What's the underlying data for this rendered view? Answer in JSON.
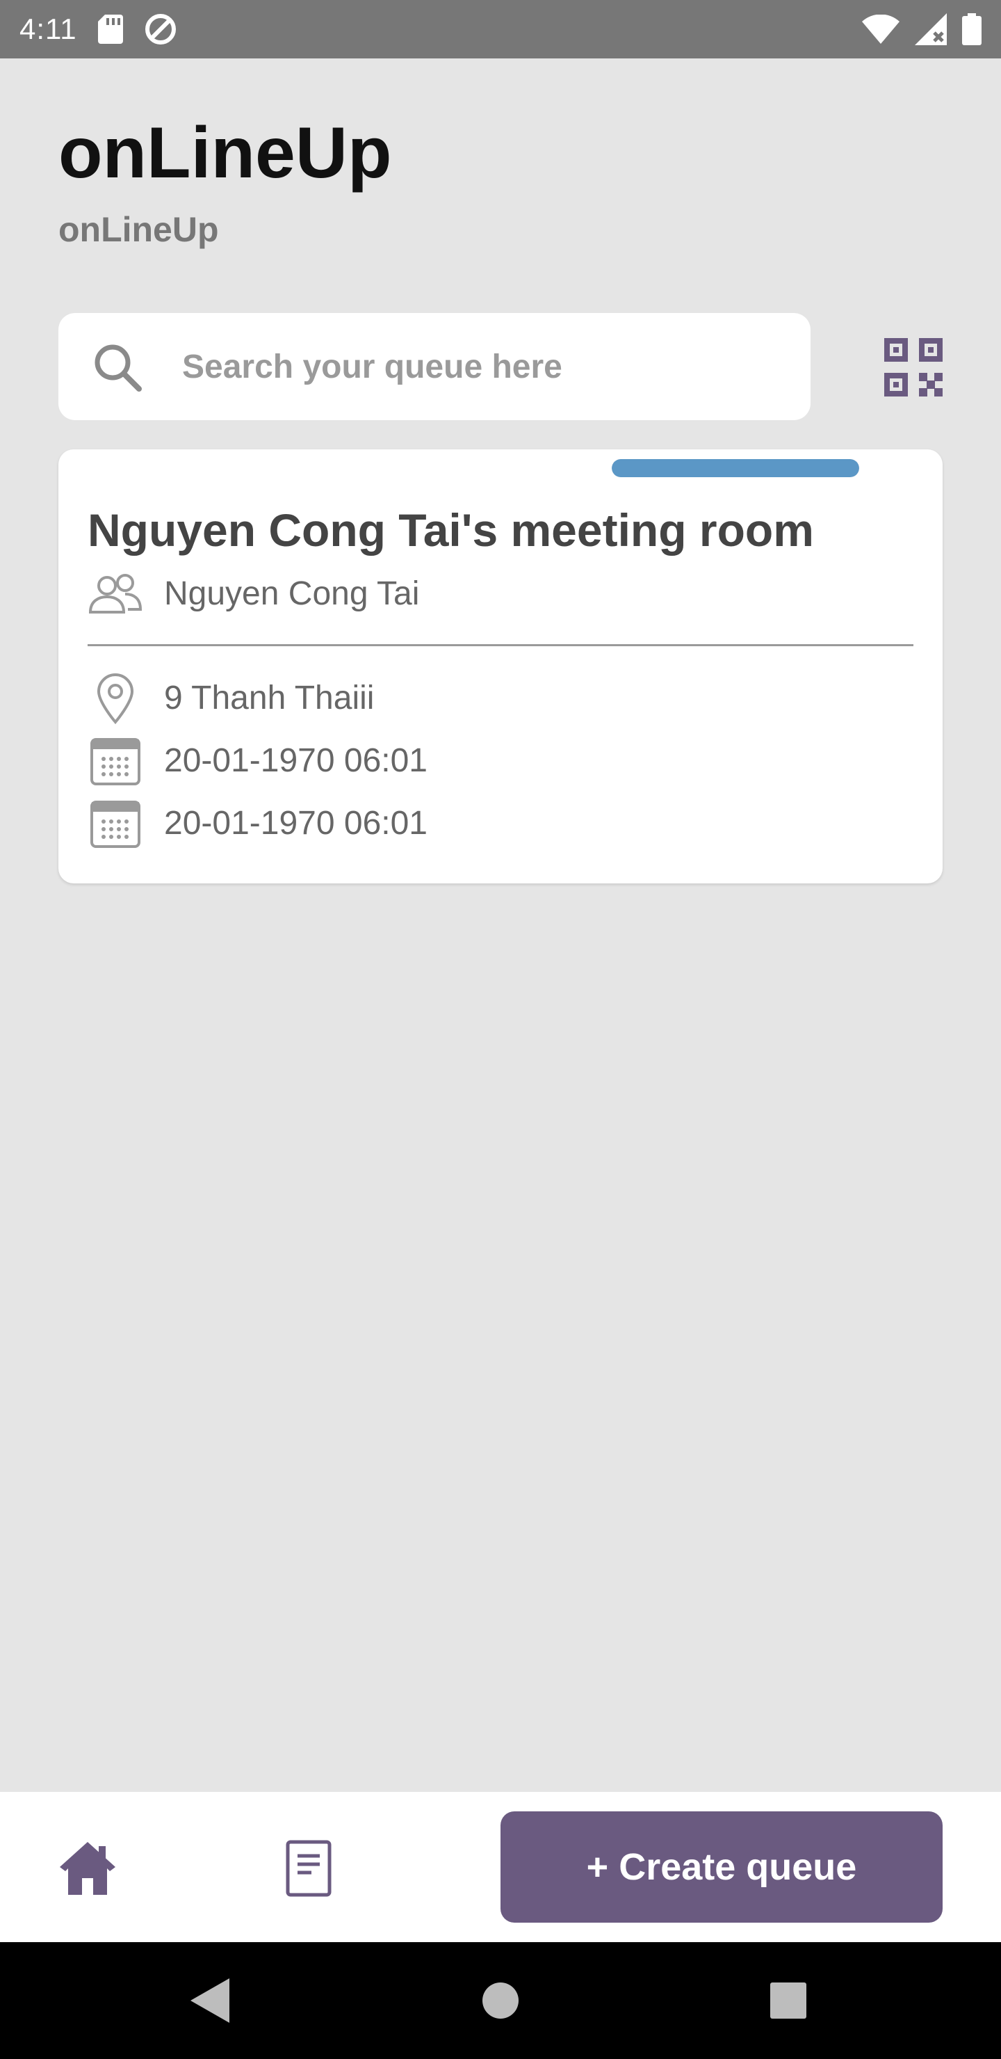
{
  "status_bar": {
    "time": "4:11",
    "icons": [
      "sd-card-icon",
      "data-saver-icon",
      "wifi-icon",
      "signal-icon",
      "battery-icon"
    ]
  },
  "header": {
    "title": "onLineUp",
    "subtitle": "onLineUp"
  },
  "search": {
    "placeholder": "Search your queue here",
    "value": "",
    "icon": "search-icon"
  },
  "qr_button": {
    "icon": "qr-code-icon"
  },
  "queue_card": {
    "progress_fraction": 1.0,
    "progress_color": "#5b97c6",
    "title": "Nguyen Cong Tai's meeting room",
    "owner": "Nguyen Cong Tai",
    "owner_icon": "people-icon",
    "location": "9 Thanh Thaiii",
    "location_icon": "location-pin-icon",
    "start_time": "20-01-1970 06:01",
    "end_time": "20-01-1970 06:01",
    "time_icon": "calendar-icon"
  },
  "bottom_nav": {
    "home_icon": "home-icon",
    "doc_icon": "document-icon",
    "create_label": "+ Create queue",
    "accent_color": "#6a5a80"
  },
  "system_nav": {
    "back_icon": "back-icon",
    "home_icon": "home-circle-icon",
    "recents_icon": "recents-icon"
  },
  "colors": {
    "background": "#e5e5e5",
    "status_bar": "#777777",
    "accent": "#6a5a80",
    "progress": "#5b97c6"
  }
}
